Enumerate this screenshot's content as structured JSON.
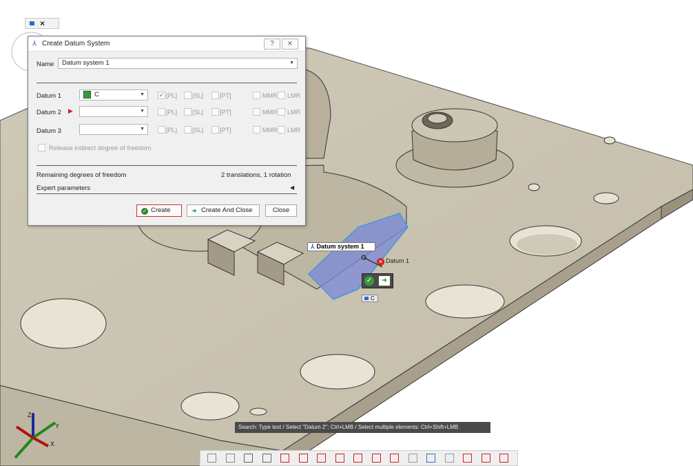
{
  "mini_toolbar": {
    "close_symbol": "×"
  },
  "dialog": {
    "title": "Create Datum System",
    "title_icon": "datum-system-icon",
    "help_symbol": "?",
    "close_symbol": "⨯",
    "name_label": "Name",
    "name_value": "Datum system 1",
    "datums": [
      {
        "label": "Datum 1",
        "value": "C",
        "has_green_icon": true,
        "pl_checked": true
      },
      {
        "label": "Datum 2",
        "value": "",
        "has_arrow": true,
        "pl_checked": false
      },
      {
        "label": "Datum 3",
        "value": "",
        "pl_checked": false
      }
    ],
    "options": [
      "[PL]",
      "[SL]",
      "[PT]",
      "MMR",
      "LMR"
    ],
    "release_label": "Release indirect degree of freedom",
    "remaining_label": "Remaining degrees of freedom",
    "remaining_value": "2 translations, 1 rotation",
    "expert_label": "Expert parameters",
    "buttons": {
      "create": "Create",
      "create_close": "Create And Close",
      "close": "Close"
    }
  },
  "scene": {
    "datum_system_tag": "Datum system 1",
    "datum1_tag": "Datum 1",
    "c_tag": "C",
    "axes": {
      "z": "Z",
      "y": "Y",
      "x": "X"
    }
  },
  "status": "Search: Type text / Select \"Datum 2\": Ctrl+LMB / Select multiple elements: Ctrl+Shift+LMB",
  "colors": {
    "part": "#d6d0c0",
    "part_dark": "#a79f8c",
    "selection": "#7a88d8",
    "accent_red": "#e02020",
    "ok_green": "#3a9a3a"
  }
}
